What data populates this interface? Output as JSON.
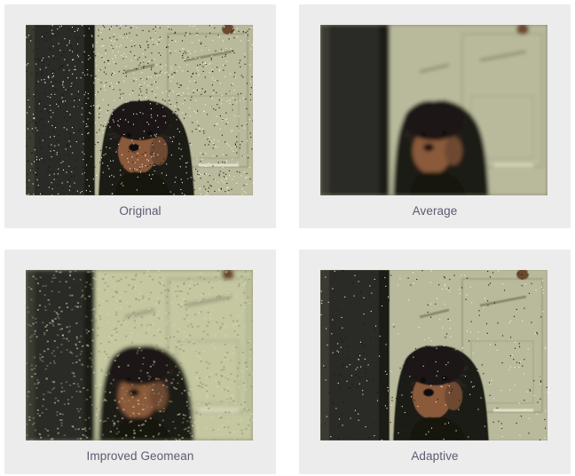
{
  "gallery": {
    "items": [
      {
        "caption": "Original",
        "filter": "none",
        "noise": "heavy"
      },
      {
        "caption": "Average",
        "filter": "blur",
        "noise": "none"
      },
      {
        "caption": "Improved Geomean",
        "filter": "blur-bright",
        "noise": "mottled"
      },
      {
        "caption": "Adaptive",
        "filter": "none",
        "noise": "light"
      }
    ]
  },
  "colors": {
    "card_background": "#ececec",
    "caption_text": "#5b5b73",
    "wall": "#b9b99b",
    "door_frame": "#2c2c26",
    "dog_dark": "#1e1a16",
    "dog_tan": "#8a5a3a"
  },
  "icons": [
    "dog-photo"
  ]
}
